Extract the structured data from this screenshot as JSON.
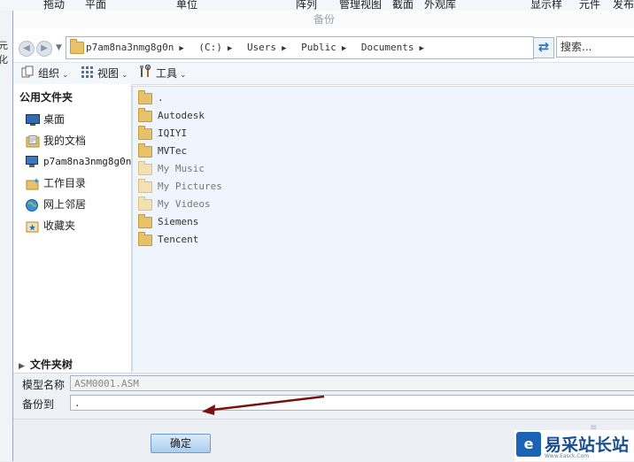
{
  "app": {
    "ribbon_items": [
      "拖动",
      "平面",
      "单位",
      "阵列",
      "管理视图",
      "截面",
      "外观库",
      "显示样",
      "元件",
      "发布"
    ],
    "side_label": "元化"
  },
  "dialog": {
    "title": "备份",
    "address": {
      "crumbs": [
        "p7am8na3nmg8g0n",
        "(C:)",
        "Users",
        "Public",
        "Documents"
      ]
    },
    "search": {
      "placeholder": "搜索..."
    },
    "commands": {
      "organize": "组织",
      "views": "视图",
      "tools": "工具"
    },
    "nav_pane": {
      "header": "公用文件夹",
      "items": [
        {
          "label": "桌面",
          "icon": "desktop-icon"
        },
        {
          "label": "我的文档",
          "icon": "documents-icon"
        },
        {
          "label": "p7am8na3nmg8g0n",
          "icon": "computer-icon"
        },
        {
          "label": "工作目录",
          "icon": "working-folder-icon"
        },
        {
          "label": "网上邻居",
          "icon": "network-icon"
        },
        {
          "label": "收藏夹",
          "icon": "favorites-icon"
        }
      ],
      "tree_toggle": "文件夹树"
    },
    "files": [
      {
        "name": ".",
        "dim": false
      },
      {
        "name": "Autodesk",
        "dim": false
      },
      {
        "name": "IQIYI",
        "dim": false
      },
      {
        "name": "MVTec",
        "dim": false
      },
      {
        "name": "My Music",
        "dim": true
      },
      {
        "name": "My Pictures",
        "dim": true
      },
      {
        "name": "My Videos",
        "dim": true
      },
      {
        "name": "Siemens",
        "dim": false
      },
      {
        "name": "Tencent",
        "dim": false
      }
    ],
    "fields": {
      "model_name_label": "模型名称",
      "model_name_value": "ASM0001.ASM",
      "backup_to_label": "备份到",
      "backup_to_value": "."
    },
    "ok_label": "确定"
  },
  "watermark": {
    "text": "易采站长站",
    "sub": "Www.Easck.Com",
    "logo": "e"
  },
  "colors": {
    "accent": "#2a74c6",
    "folder": "#e7c26b",
    "arrow": "#7a1010",
    "list_bg": "#eef5fc"
  }
}
